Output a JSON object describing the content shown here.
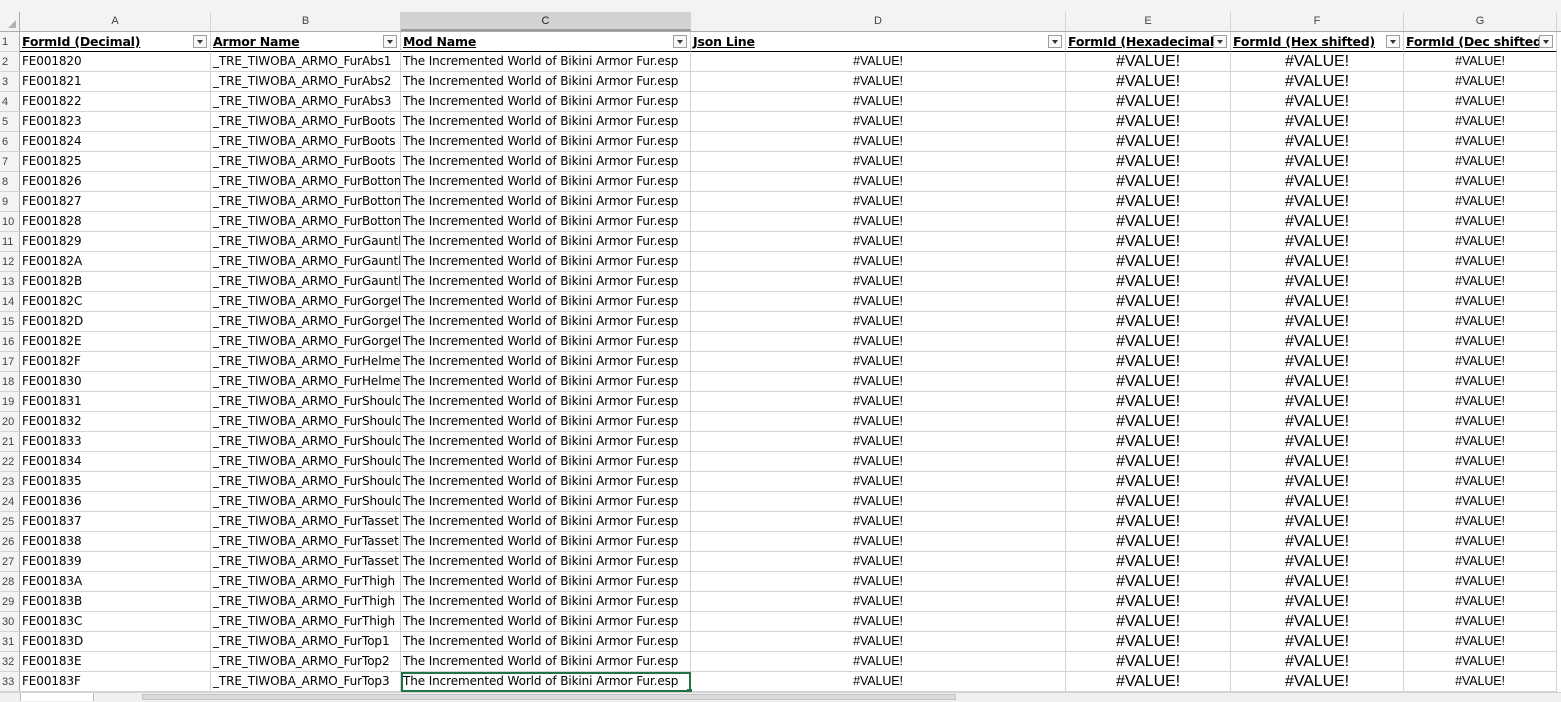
{
  "columns": [
    "A",
    "B",
    "C",
    "D",
    "E",
    "F",
    "G"
  ],
  "headers": [
    "FormId (Decimal)",
    "Armor Name",
    "Mod Name",
    "Json Line",
    "FormId (Hexadecimal)",
    "FormId (Hex shifted)",
    "FormId (Dec shifted)"
  ],
  "header_row_number": "1",
  "rows": [
    {
      "n": "2",
      "a": "FE001820",
      "b": "_TRE_TIWOBA_ARMO_FurAbs1",
      "c": "The Incremented World of Bikini Armor Fur.esp",
      "d": "#VALUE!",
      "e": "#VALUE!",
      "f": "#VALUE!",
      "g": "#VALUE!"
    },
    {
      "n": "3",
      "a": "FE001821",
      "b": "_TRE_TIWOBA_ARMO_FurAbs2",
      "c": "The Incremented World of Bikini Armor Fur.esp",
      "d": "#VALUE!",
      "e": "#VALUE!",
      "f": "#VALUE!",
      "g": "#VALUE!"
    },
    {
      "n": "4",
      "a": "FE001822",
      "b": "_TRE_TIWOBA_ARMO_FurAbs3",
      "c": "The Incremented World of Bikini Armor Fur.esp",
      "d": "#VALUE!",
      "e": "#VALUE!",
      "f": "#VALUE!",
      "g": "#VALUE!"
    },
    {
      "n": "5",
      "a": "FE001823",
      "b": "_TRE_TIWOBA_ARMO_FurBoots",
      "c": "The Incremented World of Bikini Armor Fur.esp",
      "d": "#VALUE!",
      "e": "#VALUE!",
      "f": "#VALUE!",
      "g": "#VALUE!"
    },
    {
      "n": "6",
      "a": "FE001824",
      "b": "_TRE_TIWOBA_ARMO_FurBoots",
      "c": "The Incremented World of Bikini Armor Fur.esp",
      "d": "#VALUE!",
      "e": "#VALUE!",
      "f": "#VALUE!",
      "g": "#VALUE!"
    },
    {
      "n": "7",
      "a": "FE001825",
      "b": "_TRE_TIWOBA_ARMO_FurBoots",
      "c": "The Incremented World of Bikini Armor Fur.esp",
      "d": "#VALUE!",
      "e": "#VALUE!",
      "f": "#VALUE!",
      "g": "#VALUE!"
    },
    {
      "n": "8",
      "a": "FE001826",
      "b": "_TRE_TIWOBA_ARMO_FurBottom",
      "c": "The Incremented World of Bikini Armor Fur.esp",
      "d": "#VALUE!",
      "e": "#VALUE!",
      "f": "#VALUE!",
      "g": "#VALUE!"
    },
    {
      "n": "9",
      "a": "FE001827",
      "b": "_TRE_TIWOBA_ARMO_FurBottom",
      "c": "The Incremented World of Bikini Armor Fur.esp",
      "d": "#VALUE!",
      "e": "#VALUE!",
      "f": "#VALUE!",
      "g": "#VALUE!"
    },
    {
      "n": "10",
      "a": "FE001828",
      "b": "_TRE_TIWOBA_ARMO_FurBottom",
      "c": "The Incremented World of Bikini Armor Fur.esp",
      "d": "#VALUE!",
      "e": "#VALUE!",
      "f": "#VALUE!",
      "g": "#VALUE!"
    },
    {
      "n": "11",
      "a": "FE001829",
      "b": "_TRE_TIWOBA_ARMO_FurGauntlets",
      "c": "The Incremented World of Bikini Armor Fur.esp",
      "d": "#VALUE!",
      "e": "#VALUE!",
      "f": "#VALUE!",
      "g": "#VALUE!"
    },
    {
      "n": "12",
      "a": "FE00182A",
      "b": "_TRE_TIWOBA_ARMO_FurGauntlets",
      "c": "The Incremented World of Bikini Armor Fur.esp",
      "d": "#VALUE!",
      "e": "#VALUE!",
      "f": "#VALUE!",
      "g": "#VALUE!"
    },
    {
      "n": "13",
      "a": "FE00182B",
      "b": "_TRE_TIWOBA_ARMO_FurGauntlets",
      "c": "The Incremented World of Bikini Armor Fur.esp",
      "d": "#VALUE!",
      "e": "#VALUE!",
      "f": "#VALUE!",
      "g": "#VALUE!"
    },
    {
      "n": "14",
      "a": "FE00182C",
      "b": "_TRE_TIWOBA_ARMO_FurGorget",
      "c": "The Incremented World of Bikini Armor Fur.esp",
      "d": "#VALUE!",
      "e": "#VALUE!",
      "f": "#VALUE!",
      "g": "#VALUE!"
    },
    {
      "n": "15",
      "a": "FE00182D",
      "b": "_TRE_TIWOBA_ARMO_FurGorget",
      "c": "The Incremented World of Bikini Armor Fur.esp",
      "d": "#VALUE!",
      "e": "#VALUE!",
      "f": "#VALUE!",
      "g": "#VALUE!"
    },
    {
      "n": "16",
      "a": "FE00182E",
      "b": "_TRE_TIWOBA_ARMO_FurGorget",
      "c": "The Incremented World of Bikini Armor Fur.esp",
      "d": "#VALUE!",
      "e": "#VALUE!",
      "f": "#VALUE!",
      "g": "#VALUE!"
    },
    {
      "n": "17",
      "a": "FE00182F",
      "b": "_TRE_TIWOBA_ARMO_FurHelmet",
      "c": "The Incremented World of Bikini Armor Fur.esp",
      "d": "#VALUE!",
      "e": "#VALUE!",
      "f": "#VALUE!",
      "g": "#VALUE!"
    },
    {
      "n": "18",
      "a": "FE001830",
      "b": "_TRE_TIWOBA_ARMO_FurHelmet",
      "c": "The Incremented World of Bikini Armor Fur.esp",
      "d": "#VALUE!",
      "e": "#VALUE!",
      "f": "#VALUE!",
      "g": "#VALUE!"
    },
    {
      "n": "19",
      "a": "FE001831",
      "b": "_TRE_TIWOBA_ARMO_FurShoulder",
      "c": "The Incremented World of Bikini Armor Fur.esp",
      "d": "#VALUE!",
      "e": "#VALUE!",
      "f": "#VALUE!",
      "g": "#VALUE!"
    },
    {
      "n": "20",
      "a": "FE001832",
      "b": "_TRE_TIWOBA_ARMO_FurShoulder",
      "c": "The Incremented World of Bikini Armor Fur.esp",
      "d": "#VALUE!",
      "e": "#VALUE!",
      "f": "#VALUE!",
      "g": "#VALUE!"
    },
    {
      "n": "21",
      "a": "FE001833",
      "b": "_TRE_TIWOBA_ARMO_FurShoulder",
      "c": "The Incremented World of Bikini Armor Fur.esp",
      "d": "#VALUE!",
      "e": "#VALUE!",
      "f": "#VALUE!",
      "g": "#VALUE!"
    },
    {
      "n": "22",
      "a": "FE001834",
      "b": "_TRE_TIWOBA_ARMO_FurShoulder",
      "c": "The Incremented World of Bikini Armor Fur.esp",
      "d": "#VALUE!",
      "e": "#VALUE!",
      "f": "#VALUE!",
      "g": "#VALUE!"
    },
    {
      "n": "23",
      "a": "FE001835",
      "b": "_TRE_TIWOBA_ARMO_FurShoulder",
      "c": "The Incremented World of Bikini Armor Fur.esp",
      "d": "#VALUE!",
      "e": "#VALUE!",
      "f": "#VALUE!",
      "g": "#VALUE!"
    },
    {
      "n": "24",
      "a": "FE001836",
      "b": "_TRE_TIWOBA_ARMO_FurShoulder",
      "c": "The Incremented World of Bikini Armor Fur.esp",
      "d": "#VALUE!",
      "e": "#VALUE!",
      "f": "#VALUE!",
      "g": "#VALUE!"
    },
    {
      "n": "25",
      "a": "FE001837",
      "b": "_TRE_TIWOBA_ARMO_FurTasset",
      "c": "The Incremented World of Bikini Armor Fur.esp",
      "d": "#VALUE!",
      "e": "#VALUE!",
      "f": "#VALUE!",
      "g": "#VALUE!"
    },
    {
      "n": "26",
      "a": "FE001838",
      "b": "_TRE_TIWOBA_ARMO_FurTasset",
      "c": "The Incremented World of Bikini Armor Fur.esp",
      "d": "#VALUE!",
      "e": "#VALUE!",
      "f": "#VALUE!",
      "g": "#VALUE!"
    },
    {
      "n": "27",
      "a": "FE001839",
      "b": "_TRE_TIWOBA_ARMO_FurTasset",
      "c": "The Incremented World of Bikini Armor Fur.esp",
      "d": "#VALUE!",
      "e": "#VALUE!",
      "f": "#VALUE!",
      "g": "#VALUE!"
    },
    {
      "n": "28",
      "a": "FE00183A",
      "b": "_TRE_TIWOBA_ARMO_FurThigh",
      "c": "The Incremented World of Bikini Armor Fur.esp",
      "d": "#VALUE!",
      "e": "#VALUE!",
      "f": "#VALUE!",
      "g": "#VALUE!"
    },
    {
      "n": "29",
      "a": "FE00183B",
      "b": "_TRE_TIWOBA_ARMO_FurThigh",
      "c": "The Incremented World of Bikini Armor Fur.esp",
      "d": "#VALUE!",
      "e": "#VALUE!",
      "f": "#VALUE!",
      "g": "#VALUE!"
    },
    {
      "n": "30",
      "a": "FE00183C",
      "b": "_TRE_TIWOBA_ARMO_FurThigh",
      "c": "The Incremented World of Bikini Armor Fur.esp",
      "d": "#VALUE!",
      "e": "#VALUE!",
      "f": "#VALUE!",
      "g": "#VALUE!"
    },
    {
      "n": "31",
      "a": "FE00183D",
      "b": "_TRE_TIWOBA_ARMO_FurTop1",
      "c": "The Incremented World of Bikini Armor Fur.esp",
      "d": "#VALUE!",
      "e": "#VALUE!",
      "f": "#VALUE!",
      "g": "#VALUE!"
    },
    {
      "n": "32",
      "a": "FE00183E",
      "b": "_TRE_TIWOBA_ARMO_FurTop2",
      "c": "The Incremented World of Bikini Armor Fur.esp",
      "d": "#VALUE!",
      "e": "#VALUE!",
      "f": "#VALUE!",
      "g": "#VALUE!"
    },
    {
      "n": "33",
      "a": "FE00183F",
      "b": "_TRE_TIWOBA_ARMO_FurTop3",
      "c": "The Incremented World of Bikini Armor Fur.esp",
      "d": "#VALUE!",
      "e": "#VALUE!",
      "f": "#VALUE!",
      "g": "#VALUE!"
    }
  ],
  "active_cell": "C33",
  "colors": {
    "accent": "#217346",
    "grid": "#d4d4d4",
    "header_bg": "#f3f3f3",
    "selected_header_bg": "#d2d2d2"
  }
}
